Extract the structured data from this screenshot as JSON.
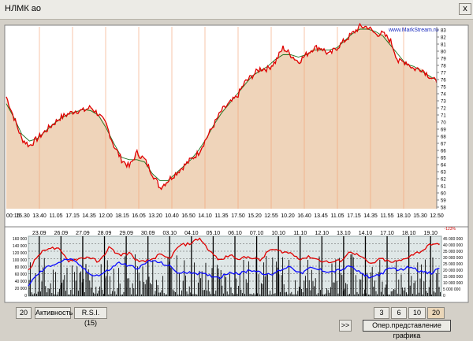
{
  "window": {
    "title": "НЛМК ао",
    "close_glyph": "x",
    "icon_close": "close-icon"
  },
  "colors": {
    "panel_bg": "#d4d0c8",
    "price_fill": "#efd4ba",
    "price_line": "#e00000",
    "ma_line": "#1c6e1c",
    "volume_line": "#0a0aff",
    "top_plot_bg": "#ffffff",
    "lower_plot_bg": "#dfe7e7"
  },
  "chart_data": [
    {
      "type": "line",
      "title": "",
      "watermark": "www.MarkStream.ru",
      "ylim": [
        57,
        83
      ],
      "y_ticks": [
        "83",
        "82",
        "81",
        "80",
        "79",
        "78",
        "77",
        "76",
        "75",
        "74",
        "73",
        "72",
        "71",
        "70",
        "69",
        "68",
        "67",
        "66",
        "65",
        "64",
        "63",
        "62",
        "61",
        "60",
        "59",
        "58"
      ],
      "x_tick_labels": [
        "00:15",
        "15.30",
        "13.40",
        "11.05",
        "17.15",
        "14.35",
        "12.00",
        "18.15",
        "16.05",
        "13.20",
        "10.40",
        "16.50",
        "14.10",
        "11.35",
        "17.50",
        "15.20",
        "12.55",
        "10.20",
        "16.40",
        "13.45",
        "11.05",
        "17.15",
        "14.35",
        "11.55",
        "18.10",
        "15.30",
        "12.50"
      ],
      "series": [
        {
          "values": [
            73,
            70,
            67,
            66,
            67,
            68,
            69,
            70,
            70.5,
            71,
            71,
            71.5,
            70.5,
            69,
            66,
            64,
            63,
            65,
            64,
            62,
            60,
            61,
            62,
            63,
            64,
            65,
            67,
            69,
            71,
            72,
            73,
            75,
            76,
            77,
            77,
            78,
            80,
            79,
            78,
            79,
            80,
            80,
            79,
            80,
            81,
            82,
            83,
            83,
            82,
            82,
            81,
            78,
            78,
            77,
            77,
            76,
            75
          ]
        }
      ]
    },
    {
      "type": "line",
      "title": "",
      "left_ticks": [
        "160 000",
        "140 000",
        "120 000",
        "100 000",
        "80 000",
        "60 000",
        "40 000",
        "20 000",
        "0"
      ],
      "right_ticks": [
        "45 000 000",
        "40 000 000",
        "35 000 000",
        "30 000 000",
        "25 000 000",
        "20 000 000",
        "15 000 000",
        "10 000 000",
        "5 000 000",
        "0"
      ],
      "date_labels": [
        "23.09",
        "26.09",
        "27.09",
        "28.09",
        "29.09",
        "30.09",
        "03.10",
        "04.10",
        "05.10",
        "06.10",
        "07.10",
        "10.10",
        "11.10",
        "12.10",
        "13.10",
        "14.10",
        "17.10",
        "18.10",
        "19.10"
      ],
      "corner_label": "-123%",
      "series": [
        {
          "values": [
            70,
            110,
            130,
            125,
            95,
            100,
            105,
            90,
            130,
            110,
            115,
            90,
            95,
            110,
            100,
            135,
            140,
            155,
            120,
            95,
            110,
            100,
            105,
            95,
            125,
            120,
            115,
            100,
            105,
            95,
            90,
            95,
            120,
            105,
            85,
            100,
            90,
            95,
            110,
            120,
            140,
            135
          ]
        },
        {
          "values": [
            30,
            60,
            80,
            90,
            100,
            85,
            60,
            55,
            70,
            90,
            80,
            75,
            95,
            90,
            80,
            60,
            65,
            60,
            55,
            50,
            65,
            60,
            70,
            65,
            55,
            70,
            80,
            60,
            75,
            70,
            65,
            70,
            80,
            60,
            50,
            60,
            75,
            70,
            80,
            65,
            60,
            80
          ]
        }
      ]
    }
  ],
  "controls": {
    "period_value": "20",
    "activity_label": "Активность",
    "rsi_label": "R.S.I. (15)",
    "nav_label": ">>",
    "range_3d": "3 дн.",
    "range_6d": "6 дн.",
    "range_10d": "10 дн.",
    "range_20d": "20 дн.",
    "chart_view_label": "Опер.представление графика"
  }
}
